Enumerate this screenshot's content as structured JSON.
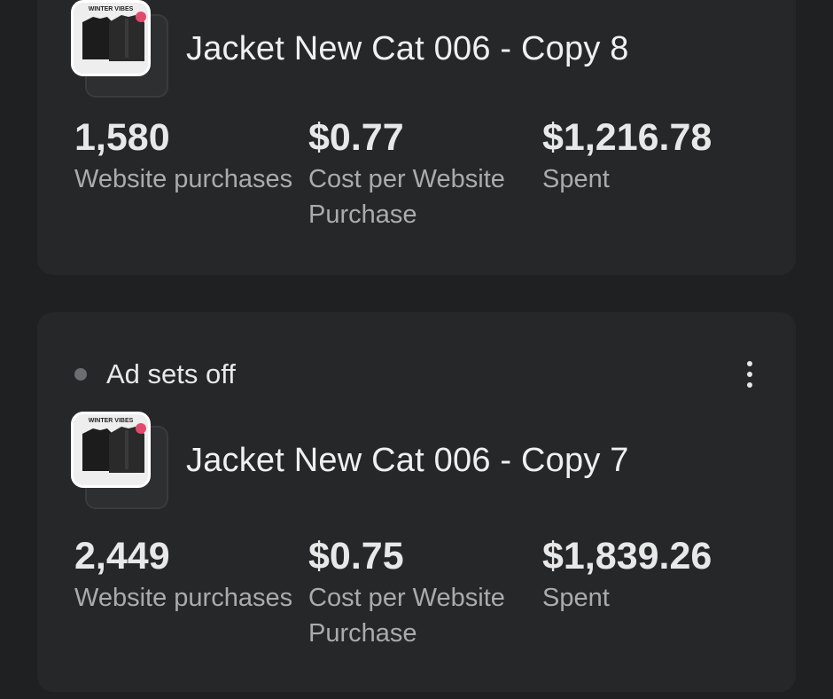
{
  "cards": [
    {
      "thumbnail_text": "WINTER VIBES",
      "title": "Jacket New Cat 006 - Copy 8",
      "metrics": [
        {
          "value": "1,580",
          "label": "Website purchases"
        },
        {
          "value": "$0.77",
          "label": "Cost per Website Purchase"
        },
        {
          "value": "$1,216.78",
          "label": "Spent"
        }
      ]
    },
    {
      "status": "Ad sets off",
      "thumbnail_text": "WINTER VIBES",
      "title": "Jacket New Cat 006 - Copy 7",
      "metrics": [
        {
          "value": "2,449",
          "label": "Website purchases"
        },
        {
          "value": "$0.75",
          "label": "Cost per Website Purchase"
        },
        {
          "value": "$1,839.26",
          "label": "Spent"
        }
      ]
    }
  ],
  "icons": {
    "status": "status-dot-icon",
    "more": "more-vertical-icon"
  },
  "colors": {
    "background": "#1f2022",
    "card": "#262729",
    "label": "#a9abad",
    "status_dot": "#6b6d70"
  }
}
